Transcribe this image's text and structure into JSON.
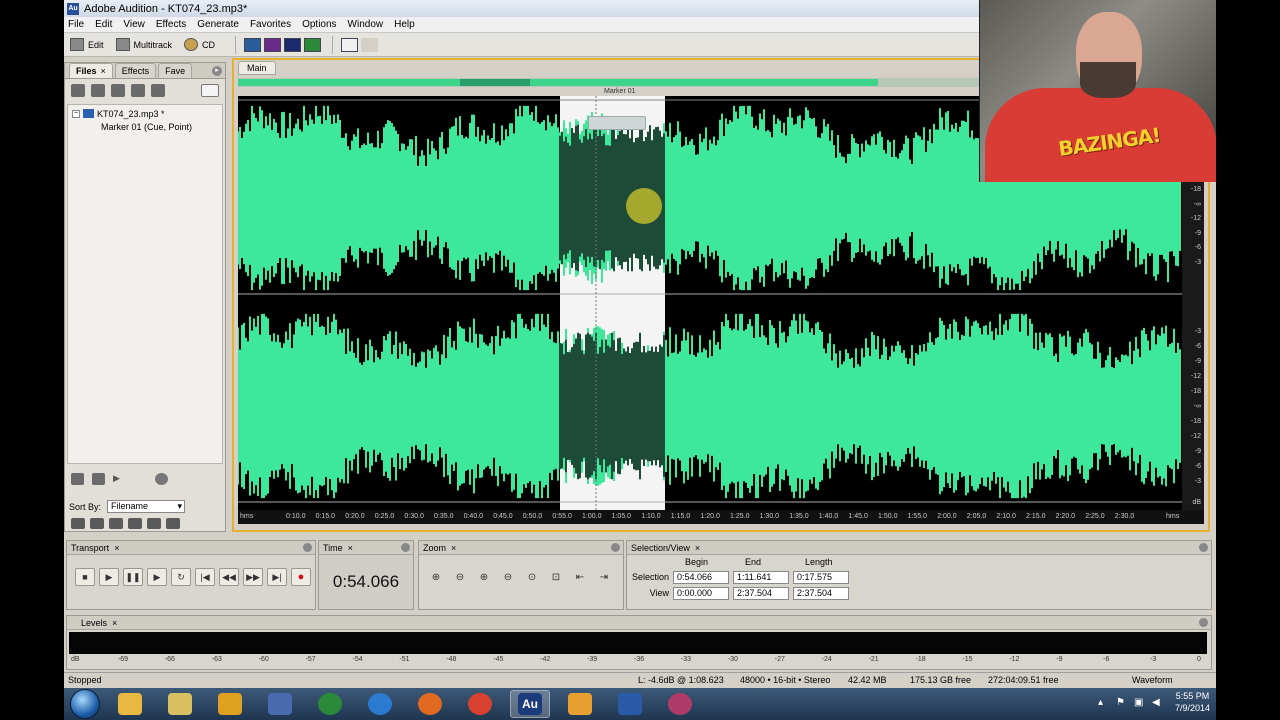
{
  "window": {
    "title": "Adobe Audition - KT074_23.mp3*",
    "logo": "Au"
  },
  "menu": [
    "File",
    "Edit",
    "View",
    "Effects",
    "Generate",
    "Favorites",
    "Options",
    "Window",
    "Help"
  ],
  "toolbar": {
    "edit_label": "Edit",
    "multitrack_label": "Multitrack",
    "cd_label": "CD"
  },
  "files_panel": {
    "tabs": [
      {
        "label": "Files",
        "close": "×"
      },
      {
        "label": "Effects",
        "close": ""
      },
      {
        "label": "Fave",
        "close": ""
      }
    ],
    "file_name": "KT074_23.mp3 *",
    "marker_item": "Marker 01 (Cue, Point)",
    "sort_label": "Sort By:",
    "sort_value": "Filename"
  },
  "editor": {
    "tab_label": "Main",
    "marker_label": "Marker 01",
    "db_ticks_top": [
      "-18",
      "-∞",
      "-12",
      "-9",
      "-6",
      "-3"
    ],
    "db_ticks_bottom": [
      "-3",
      "-6",
      "-9",
      "-12",
      "-18",
      "-∞",
      "-18",
      "-12",
      "-9",
      "-6",
      "-3"
    ],
    "db_unit": "dB",
    "time_unit": "hms",
    "time_ticks": [
      "0:10.0",
      "0:15.0",
      "0:20.0",
      "0:25.0",
      "0:30.0",
      "0:35.0",
      "0:40.0",
      "0:45.0",
      "0:50.0",
      "0:55.0",
      "1:00.0",
      "1:05.0",
      "1:10.0",
      "1:15.0",
      "1:20.0",
      "1:25.0",
      "1:30.0",
      "1:35.0",
      "1:40.0",
      "1:45.0",
      "1:50.0",
      "1:55.0",
      "2:00.0",
      "2:05.0",
      "2:10.0",
      "2:15.0",
      "2:20.0",
      "2:25.0",
      "2:30.0"
    ],
    "waveform_color": "#3ee89a",
    "selected_wave_color": "#1e4a38"
  },
  "transport": {
    "label": "Transport",
    "buttons": [
      "■",
      "▶",
      "❚❚",
      "▶",
      "↻",
      "|◀",
      "◀◀",
      "▶▶",
      "▶|",
      "●"
    ]
  },
  "time_panel": {
    "label": "Time",
    "value": "0:54.066"
  },
  "zoom_panel": {
    "label": "Zoom"
  },
  "selection_view": {
    "label": "Selection/View",
    "col_begin": "Begin",
    "col_end": "End",
    "col_length": "Length",
    "selection_label": "Selection",
    "view_label": "View",
    "selection": {
      "begin": "0:54.066",
      "end": "1:11.641",
      "length": "0:17.575"
    },
    "view": {
      "begin": "0:00.000",
      "end": "2:37.504",
      "length": "2:37.504"
    }
  },
  "levels": {
    "label": "Levels",
    "ticks": [
      "dB",
      "-69",
      "-66",
      "-63",
      "-60",
      "-57",
      "-54",
      "-51",
      "-48",
      "-45",
      "-42",
      "-39",
      "-36",
      "-33",
      "-30",
      "-27",
      "-24",
      "-21",
      "-18",
      "-15",
      "-12",
      "-9",
      "-6",
      "-3",
      "0"
    ]
  },
  "status": {
    "state": "Stopped",
    "level_readout": "L: -4.6dB @  1:08.623",
    "format": "48000 • 16-bit • Stereo",
    "file_size": "42.42 MB",
    "disk_free": "175.13 GB free",
    "time_free": "272:04:09.51 free",
    "view_mode": "Waveform"
  },
  "webcam": {
    "shirt_text": "BAZINGA!"
  },
  "taskbar": {
    "audition_label": "Au",
    "time": "5:55 PM",
    "date": "7/9/2014"
  }
}
